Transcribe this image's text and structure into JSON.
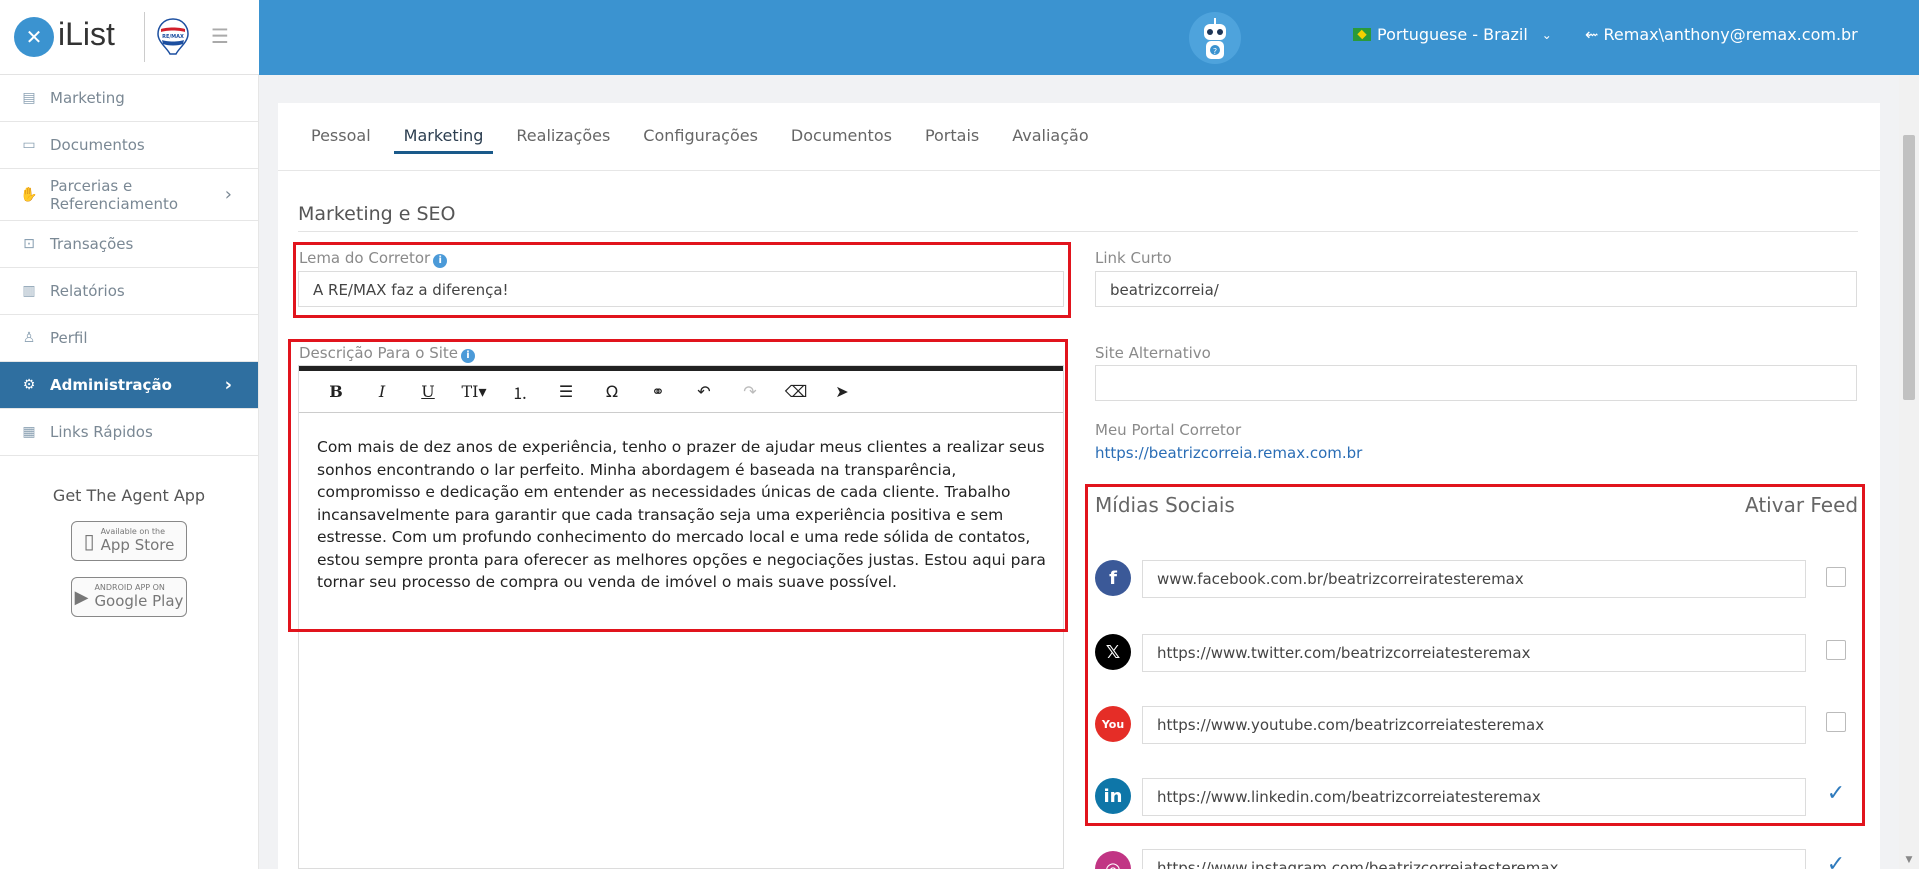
{
  "app": {
    "logo_text": "iList",
    "logo_mark": "✕",
    "brand_badge": "RE/MAX"
  },
  "header": {
    "language": "Portuguese - Brazil",
    "user": "Remax\\anthony@remax.com.br"
  },
  "sidebar": {
    "items": [
      {
        "label": "Marketing",
        "icon": "book-icon"
      },
      {
        "label": "Documentos",
        "icon": "folder-icon"
      },
      {
        "label": "Parcerias e Referenciamento",
        "icon": "handshake-icon"
      },
      {
        "label": "Transações",
        "icon": "briefcase-icon"
      },
      {
        "label": "Relatórios",
        "icon": "bar-chart-icon"
      },
      {
        "label": "Perfil",
        "icon": "user-icon"
      },
      {
        "label": "Administração",
        "icon": "gear-icon"
      },
      {
        "label": "Links Rápidos",
        "icon": "links-icon"
      }
    ],
    "get_app": "Get The Agent App",
    "app_store_small": "Available on the",
    "app_store": "App Store",
    "google_play_small": "ANDROID APP ON",
    "google_play": "Google Play"
  },
  "tabs": [
    "Pessoal",
    "Marketing",
    "Realizações",
    "Configurações",
    "Documentos",
    "Portais",
    "Avaliação"
  ],
  "active_tab": "Marketing",
  "section_title": "Marketing e SEO",
  "form": {
    "motto_label": "Lema do Corretor",
    "motto_value": "A RE/MAX faz a diferença!",
    "description_label": "Descrição Para o Site",
    "description_text": "Com mais de dez anos de experiência, tenho o prazer de ajudar meus clientes a realizar seus sonhos encontrando o lar perfeito. Minha abordagem é baseada na transparência, compromisso e dedicação em entender as necessidades únicas de cada cliente. Trabalho incansavelmente para garantir que cada transação seja uma experiência positiva e sem estresse. Com um profundo conhecimento do mercado local e uma rede sólida de contatos, estou sempre pronta para oferecer as melhores opções e negociações justas. Estou aqui para tornar seu processo de compra ou venda de imóvel o mais suave possível.",
    "short_link_label": "Link Curto",
    "short_link_value": "beatrizcorreia/",
    "alt_site_label": "Site Alternativo",
    "alt_site_value": "",
    "portal_label": "Meu Portal Corretor",
    "portal_url": "https://beatrizcorreia.remax.com.br"
  },
  "toolbar": [
    "B",
    "I",
    "U",
    "T↕▾",
    "ordered-list",
    "bullet-list",
    "Ω",
    "link",
    "undo",
    "redo",
    "eraser",
    "cursor"
  ],
  "social": {
    "title": "Mídias Sociais",
    "feed_title": "Ativar Feed",
    "items": [
      {
        "network": "facebook",
        "url": "www.facebook.com.br/beatrizcorreiratesteremax",
        "feed": false,
        "color": "#3b5998",
        "glyph": "f"
      },
      {
        "network": "twitter",
        "url": "https://www.twitter.com/beatrizcorreiatesteremax",
        "feed": false,
        "color": "#000000",
        "glyph": "𝕏"
      },
      {
        "network": "youtube",
        "url": "https://www.youtube.com/beatrizcorreiatesteremax",
        "feed": false,
        "color": "#e52d27",
        "glyph": "You"
      },
      {
        "network": "linkedin",
        "url": "https://www.linkedin.com/beatrizcorreiatesteremax",
        "feed": true,
        "color": "#0e76a8",
        "glyph": "in"
      },
      {
        "network": "instagram",
        "url": "https://www.instagram.com/beatrizcorreiatesteremax",
        "feed": true,
        "color": "#c13584",
        "glyph": "◎"
      }
    ]
  }
}
